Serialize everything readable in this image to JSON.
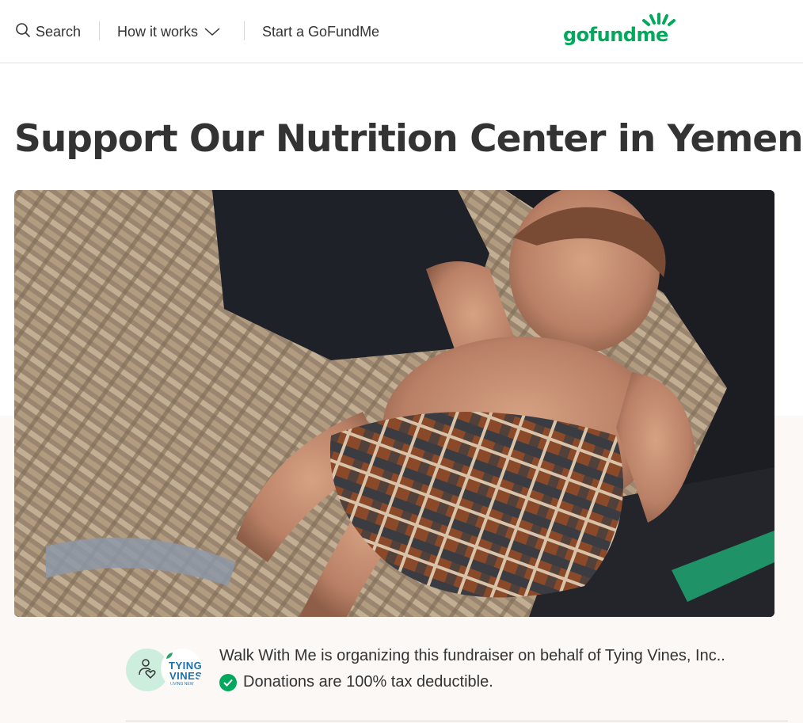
{
  "nav": {
    "search_label": "Search",
    "how_label": "How it works",
    "start_label": "Start a GoFundMe",
    "logo_text": "gofundme",
    "brand_color": "#02a95c"
  },
  "campaign": {
    "title": "Support Our Nutrition Center in Yemen",
    "organizer_text": "Walk With Me is organizing this fundraiser on behalf of Tying Vines, Inc..",
    "tax_text": "Donations are 100% tax deductible.",
    "org_logo_line1": "TYING",
    "org_logo_line2": "VINES",
    "org_logo_line3": "LIVING NEW"
  },
  "icons": {
    "search": "search-icon",
    "chevron": "chevron-down-icon",
    "heart": "person-heart-icon",
    "check": "check-circle-icon"
  }
}
